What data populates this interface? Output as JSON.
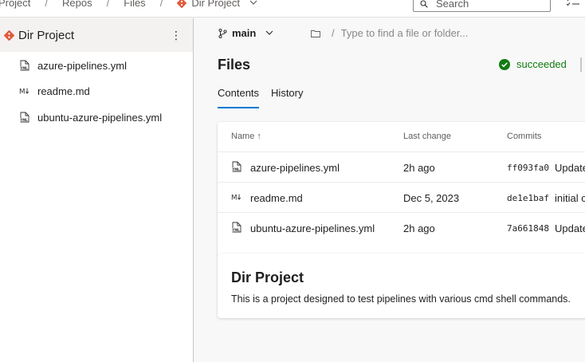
{
  "breadcrumb": {
    "items": [
      "r Project",
      "Repos",
      "Files",
      "Dir Project"
    ]
  },
  "search": {
    "placeholder": "Search"
  },
  "sidebar": {
    "title": "Dir Project",
    "more": "⋮",
    "files": [
      {
        "name": "azure-pipelines.yml",
        "icon": "yml-file-icon"
      },
      {
        "name": "readme.md",
        "icon": "markdown-file-icon"
      },
      {
        "name": "ubuntu-azure-pipelines.yml",
        "icon": "yml-file-icon"
      }
    ]
  },
  "branch": {
    "name": "main"
  },
  "path": {
    "placeholder": "Type to find a file or folder..."
  },
  "files": {
    "title": "Files",
    "status": "succeeded",
    "tabs": [
      "Contents",
      "History"
    ],
    "table": {
      "columns": [
        "Name ↑",
        "Last change",
        "Commits"
      ],
      "rows": [
        {
          "name": "azure-pipelines.yml",
          "icon": "yml-file-icon",
          "last_change": "2h ago",
          "commit": "ff093fa0",
          "message": "Update"
        },
        {
          "name": "readme.md",
          "icon": "markdown-file-icon",
          "last_change": "Dec 5, 2023",
          "commit": "de1e1baf",
          "message": "initial c"
        },
        {
          "name": "ubuntu-azure-pipelines.yml",
          "icon": "yml-file-icon",
          "last_change": "2h ago",
          "commit": "7a661848",
          "message": "Update"
        }
      ]
    }
  },
  "readme": {
    "title": "Dir Project",
    "text": "This is a project designed to test pipelines with various cmd shell commands."
  },
  "colors": {
    "accent": "#0078d4",
    "success": "#107c10",
    "git_icon": "#e05a3a"
  }
}
